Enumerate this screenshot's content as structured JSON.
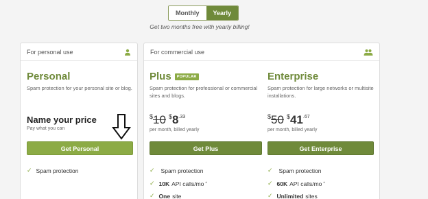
{
  "billing_toggle": {
    "monthly": "Monthly",
    "yearly": "Yearly"
  },
  "billing_note": "Get two months free with yearly billing!",
  "personal_card": {
    "header": "For personal use",
    "plan": {
      "name": "Personal",
      "description": "Spam protection for your personal site or blog.",
      "price_label": "Name your price",
      "price_note": "Pay what you can",
      "button": "Get Personal",
      "features": [
        "Spam protection"
      ]
    }
  },
  "commercial_card": {
    "header": "For commercial use",
    "plus": {
      "name": "Plus",
      "badge": "POPULAR",
      "description": "Spam protection for professional or commercial sites and blogs.",
      "old_currency": "$",
      "old_price": "10",
      "currency": "$",
      "price": "8",
      "cents": ".33",
      "period": "per month, billed yearly",
      "button": "Get Plus",
      "features": [
        {
          "bold": "",
          "text": "Spam protection",
          "sup": ""
        },
        {
          "bold": "10K",
          "text": "API calls/mo",
          "sup": "*"
        },
        {
          "bold": "One",
          "text": "site",
          "sup": ""
        }
      ]
    },
    "enterprise": {
      "name": "Enterprise",
      "description": "Spam protection for large networks or multisite installations.",
      "old_currency": "$",
      "old_price": "50",
      "currency": "$",
      "price": "41",
      "cents": ".67",
      "period": "per month, billed yearly",
      "button": "Get Enterprise",
      "features": [
        {
          "bold": "",
          "text": "Spam protection",
          "sup": ""
        },
        {
          "bold": "60K",
          "text": "API calls/mo",
          "sup": "*"
        },
        {
          "bold": "Unlimited",
          "text": "sites",
          "sup": ""
        }
      ]
    }
  },
  "icons": {
    "personal": "user-icon",
    "commercial": "group-icon",
    "check": "check-icon",
    "arrow": "down-arrow-annotation"
  },
  "colors": {
    "accent": "#6f8a3a",
    "accent_light": "#8cab45"
  }
}
